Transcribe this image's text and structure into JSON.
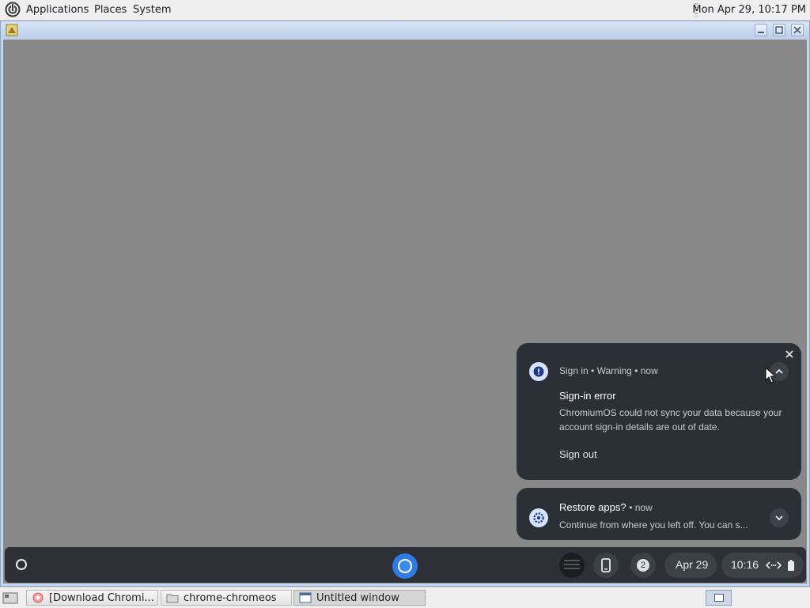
{
  "top_panel": {
    "menus": [
      "Applications",
      "Places",
      "System"
    ],
    "clock": "Mon Apr 29, 10:17 PM"
  },
  "window": {
    "icons": {
      "app": "app-icon",
      "minimize": "minimize-icon",
      "maximize": "maximize-icon",
      "close": "close-icon"
    }
  },
  "notifications": [
    {
      "icon": "warning-icon",
      "source": "Sign in",
      "severity": "Warning",
      "time": "now",
      "title": "Sign-in error",
      "body": "ChromiumOS could not sync your data because your account sign-in details are out of date.",
      "action": "Sign out"
    },
    {
      "icon": "settings-icon",
      "title": "Restore apps?",
      "time": "now",
      "body": "Continue from where you left off. You can s..."
    }
  ],
  "shelf": {
    "notification_count": "2",
    "date": "Apr 29",
    "time": "10:16"
  },
  "taskbar": {
    "tasks": [
      {
        "label": "[Download Chromi...",
        "icon": "browser-icon"
      },
      {
        "label": "chrome-chromeos",
        "icon": "folder-icon"
      },
      {
        "label": "Untitled window",
        "icon": "window-icon"
      }
    ]
  },
  "colors": {
    "desktop_gray": "#888888",
    "notification_bg": "#2b2f36",
    "shelf_bg": "#2d3036",
    "accent_blue": "#2e7be3"
  }
}
